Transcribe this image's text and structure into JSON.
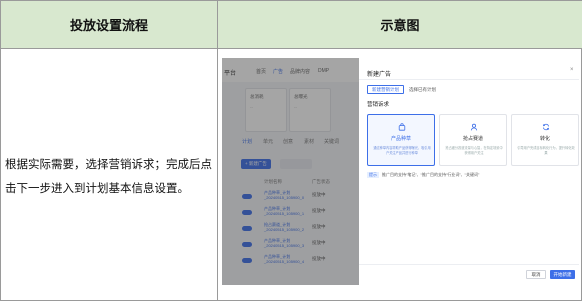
{
  "table": {
    "header_left": "投放设置流程",
    "header_right": "示意图",
    "description": "根据实际需要，选择营销诉求；完成后点击下一步进入到计划基本信息设置。"
  },
  "app": {
    "brand": "平台",
    "nav": [
      "首页",
      "广告",
      "品牌内容",
      "DMP"
    ],
    "cards": [
      {
        "label": "总消耗",
        "value": "--"
      },
      {
        "label": "总曝光",
        "value": "--"
      }
    ],
    "subtabs": [
      "计划",
      "单元",
      "创意",
      "素材",
      "关键词"
    ],
    "new_button": "+ 新建广告",
    "columns": [
      "计划名称",
      "广告状态"
    ],
    "rows": [
      {
        "name": "产品种草_计划_20240515_105900_0",
        "status": "投放中"
      },
      {
        "name": "产品种草_计划_20240515_105900_1",
        "status": "投放中"
      },
      {
        "name": "抢占赛道_计划_20240515_105900_2",
        "status": "投放中"
      },
      {
        "name": "产品种草_计划_20240515_105900_3",
        "status": "投放中"
      },
      {
        "name": "产品种草_计划_20240515_105900_4",
        "status": "投放中"
      }
    ]
  },
  "drawer": {
    "title": "新建广告",
    "close_icon": "close-icon",
    "seg_active": "新建营销计划",
    "seg_other": "选择已有计划",
    "section_title": "营销诉求",
    "goals": [
      {
        "name": "产品种草",
        "desc": "通过种草内容帮助产品获得曝光，吸引用户关注产品并进行种草",
        "icon": "bag-icon",
        "selected": true
      },
      {
        "name": "抢占赛道",
        "desc": "抢占细分赛道流量与心智，在特定场景中获得用户关注",
        "icon": "user-icon",
        "selected": false
      },
      {
        "name": "转化",
        "desc": "引导用户完成目标转化行为，提升转化效果",
        "icon": "refresh-icon",
        "selected": false
      }
    ],
    "note_tag": "提示",
    "note_text": "推广目的支持“笔记”、“推广目的支持“行业词”、“关键词”",
    "cancel_label": "取消",
    "create_label": "开始新建"
  },
  "colors": {
    "header_bg": "#d8e8cf",
    "accent": "#3d6fe8"
  }
}
